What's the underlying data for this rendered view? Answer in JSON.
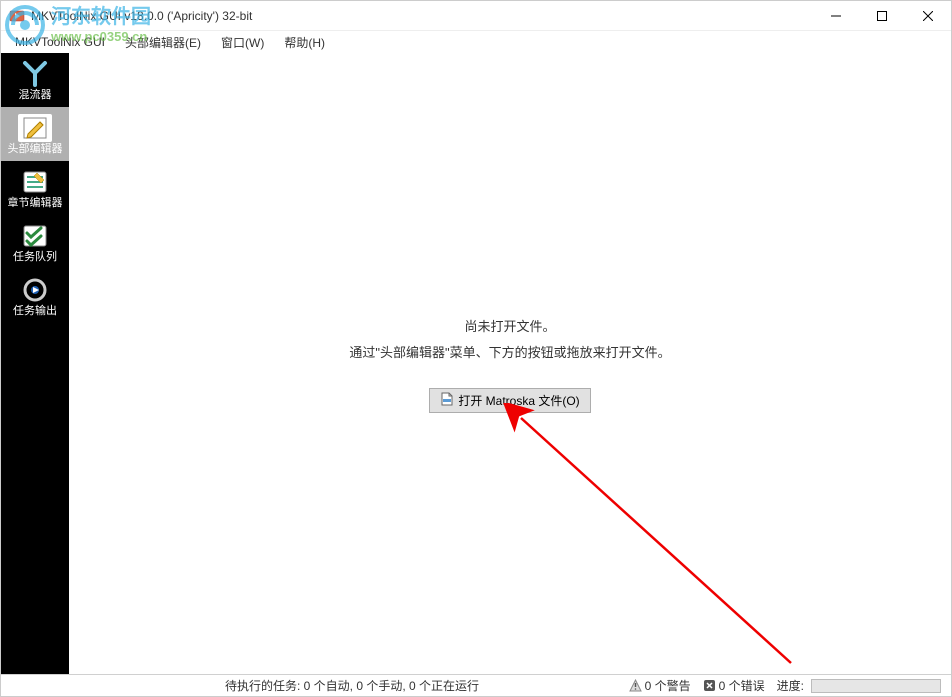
{
  "window": {
    "title": "MKVToolNix GUI v18.0.0 ('Apricity') 32-bit"
  },
  "menu": {
    "items": [
      "MKVToolNix GUI",
      "头部编辑器(E)",
      "窗口(W)",
      "帮助(H)"
    ]
  },
  "sidebar": {
    "items": [
      {
        "label": "混流器",
        "icon": "mux-icon"
      },
      {
        "label": "头部编辑器",
        "icon": "edit-icon",
        "selected": true
      },
      {
        "label": "章节编辑器",
        "icon": "chapter-icon"
      },
      {
        "label": "任务队列",
        "icon": "queue-icon"
      },
      {
        "label": "任务输出",
        "icon": "output-icon"
      }
    ]
  },
  "main": {
    "line1": "尚未打开文件。",
    "line2": "通过\"头部编辑器\"菜单、下方的按钮或拖放来打开文件。",
    "open_button": "打开 Matroska 文件(O)"
  },
  "status": {
    "pending": "待执行的任务: 0 个自动, 0 个手动, 0 个正在运行",
    "warnings": "0 个警告",
    "errors": "0 个错误",
    "progress_label": "进度:"
  },
  "watermark": {
    "brand": "河东软件园",
    "url": "www.pc0359.cn"
  }
}
